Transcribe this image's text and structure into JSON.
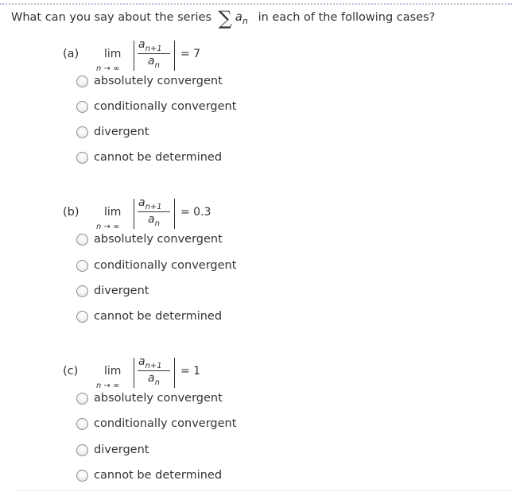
{
  "question": {
    "prefix": "What can you say about the series",
    "sigma": "∑",
    "term_base": "a",
    "term_sub": "n",
    "suffix": "in each of the following cases?"
  },
  "limit_expression": {
    "lim": "lim",
    "lim_sub": "n → ∞",
    "numerator_base": "a",
    "numerator_sub": "n+1",
    "denominator_base": "a",
    "denominator_sub": "n"
  },
  "parts": [
    {
      "label": "(a)",
      "equals": "= 7",
      "options": [
        "absolutely convergent",
        "conditionally convergent",
        "divergent",
        "cannot be determined"
      ],
      "selected": null
    },
    {
      "label": "(b)",
      "equals": "= 0.3",
      "options": [
        "absolutely convergent",
        "conditionally convergent",
        "divergent",
        "cannot be determined"
      ],
      "selected": null
    },
    {
      "label": "(c)",
      "equals": "= 1",
      "options": [
        "absolutely convergent",
        "conditionally convergent",
        "divergent",
        "cannot be determined"
      ],
      "selected": null
    }
  ]
}
